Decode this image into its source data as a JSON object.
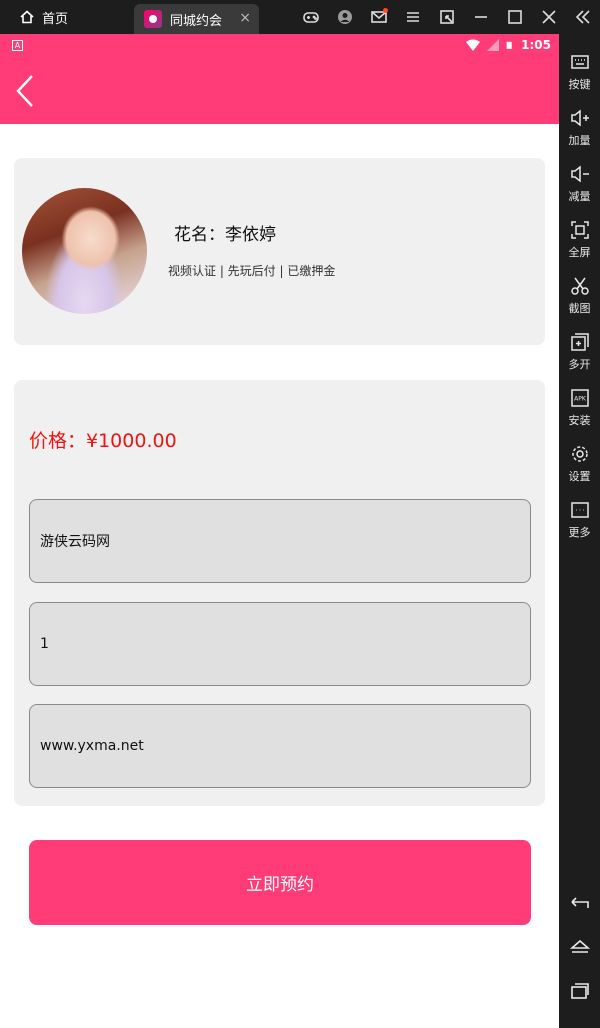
{
  "titlebar": {
    "home_tab": "首页",
    "app_tab": "同城约会",
    "close_tab": "×",
    "icons": [
      "gamepad-icon",
      "account-icon",
      "mail-icon",
      "menu-icon",
      "window-shrink-icon",
      "minimize-icon",
      "maximize-icon",
      "close-icon",
      "collapse-sidebar-icon"
    ]
  },
  "sidebar": {
    "items": [
      {
        "icon": "keyboard-icon",
        "label": "按键"
      },
      {
        "icon": "volume-up-icon",
        "label": "加量"
      },
      {
        "icon": "volume-down-icon",
        "label": "减量"
      },
      {
        "icon": "fullscreen-icon",
        "label": "全屏"
      },
      {
        "icon": "scissors-icon",
        "label": "截图"
      },
      {
        "icon": "multi-open-icon",
        "label": "多开"
      },
      {
        "icon": "apk-icon",
        "label": "安装"
      },
      {
        "icon": "gear-icon",
        "label": "设置"
      },
      {
        "icon": "more-icon",
        "label": "更多"
      }
    ],
    "nav": [
      "back-icon",
      "home-icon",
      "recents-icon"
    ]
  },
  "statusbar": {
    "notification": "A",
    "time": "1:05"
  },
  "profile": {
    "flower_name": "花名：李依婷",
    "tags": "视频认证 | 先玩后付 | 已缴押金"
  },
  "form": {
    "price": "价格：¥1000.00",
    "fields": [
      "游侠云码网",
      "1",
      "www.yxma.net"
    ]
  },
  "actions": {
    "submit": "立即预约"
  },
  "colors": {
    "brand_pink": "#ff3b78",
    "price_red": "#ef1414",
    "card_bg": "#f0f0f0",
    "field_bg": "#e0e0e0"
  }
}
